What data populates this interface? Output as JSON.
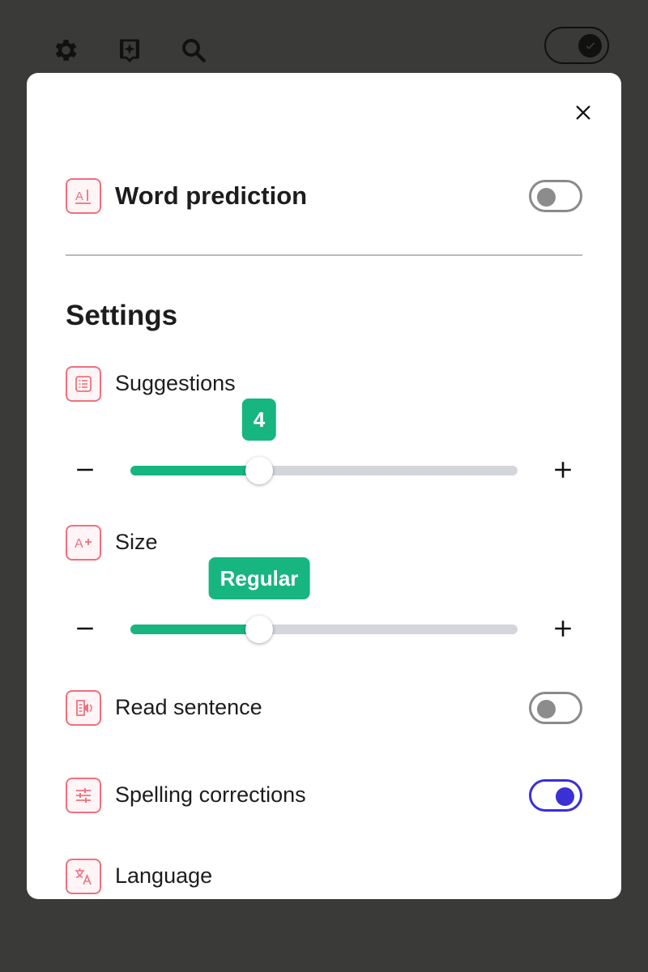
{
  "topbar": {
    "icons": [
      "gear-icon",
      "sparkle-bookmark-icon",
      "search-icon"
    ],
    "toggle_on": true
  },
  "panel": {
    "close_icon": "close-icon",
    "word_prediction": {
      "label": "Word prediction",
      "icon": "ai-text-icon",
      "enabled": false
    },
    "settings_title": "Settings",
    "suggestions": {
      "label": "Suggestions",
      "icon": "list-icon",
      "value": "4",
      "level": 0.333
    },
    "size": {
      "label": "Size",
      "icon": "text-size-plus-icon",
      "value": "Regular",
      "level": 0.333
    },
    "read_sentence": {
      "label": "Read sentence",
      "icon": "speaker-document-icon",
      "enabled": false
    },
    "spelling_corrections": {
      "label": "Spelling corrections",
      "icon": "sliders-icon",
      "enabled": true
    },
    "language": {
      "label": "Language",
      "icon": "translate-icon"
    }
  },
  "colors": {
    "accent_green": "#17b57f",
    "toggle_on": "#3b2fd6",
    "icon_pink": "#f0707e",
    "backdrop": "#3a3a38"
  }
}
